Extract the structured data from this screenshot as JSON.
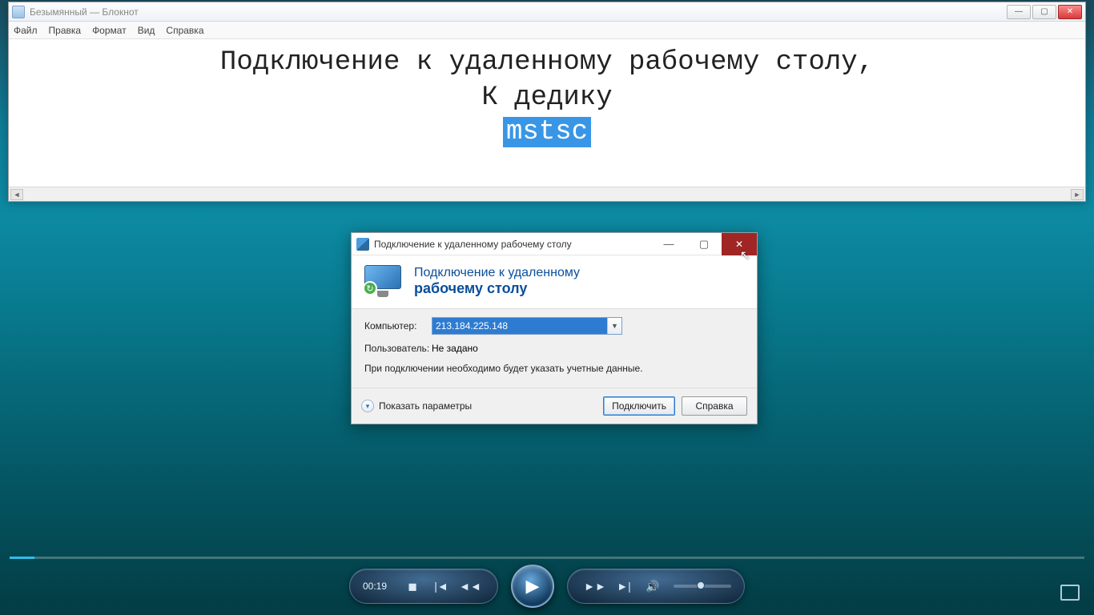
{
  "notepad": {
    "title": "Безымянный — Блокнот",
    "menu": {
      "file": "Файл",
      "edit": "Правка",
      "format": "Формат",
      "view": "Вид",
      "help": "Справка"
    },
    "line1": "Подключение к удаленному рабочему столу,",
    "line2": "К дедику",
    "selected": "mstsc"
  },
  "rdp": {
    "window_title": "Подключение к удаленному рабочему столу",
    "banner_line1": "Подключение к удаленному",
    "banner_line2": "рабочему столу",
    "computer_label": "Компьютер:",
    "computer_value": "213.184.225.148",
    "user_label": "Пользователь:",
    "user_value": "Не задано",
    "hint": "При подключении необходимо будет указать учетные данные.",
    "show_options": "Показать параметры",
    "connect": "Подключить",
    "help": "Справка"
  },
  "player": {
    "time": "00:19"
  }
}
